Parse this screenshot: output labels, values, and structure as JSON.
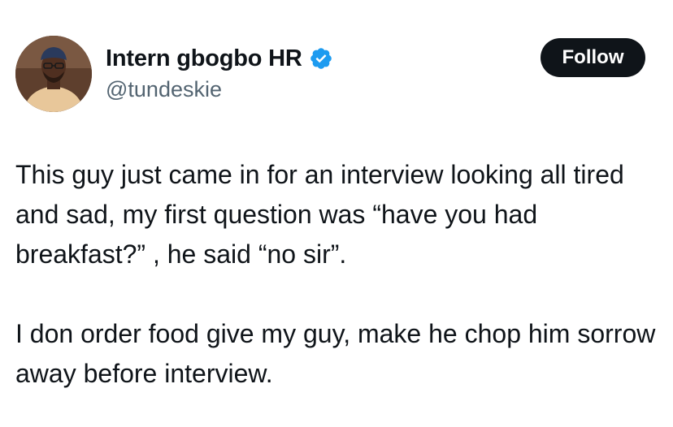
{
  "author": {
    "display_name": "Intern gbogbo HR",
    "handle": "@tundeskie",
    "verified": true,
    "avatar_icon": "profile-photo"
  },
  "actions": {
    "follow_label": "Follow"
  },
  "tweet": {
    "paragraphs": [
      "This guy just came in for an interview looking all tired and sad, my first question was “have you had breakfast?” , he said “no sir”.",
      "I don order food give my guy, make he chop him sorrow away before interview."
    ]
  },
  "colors": {
    "text": "#0f1419",
    "secondary_text": "#536471",
    "verified_badge": "#1d9bf0",
    "follow_button_bg": "#0f1419",
    "follow_button_text": "#ffffff"
  }
}
